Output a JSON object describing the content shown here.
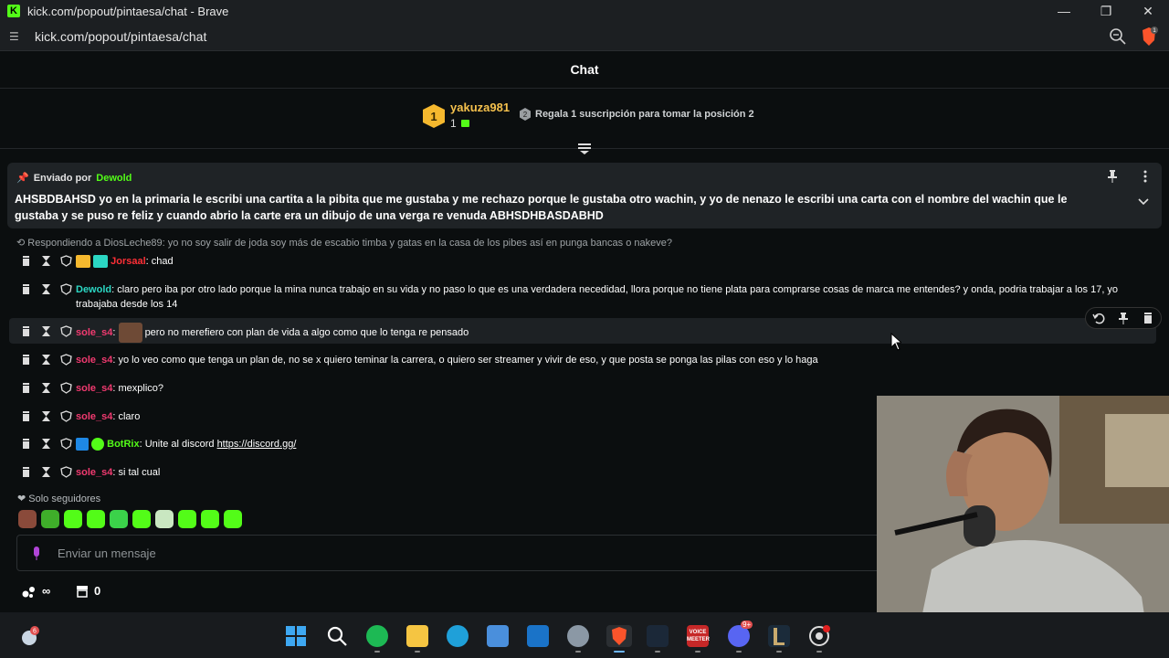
{
  "browser": {
    "window_title": "kick.com/popout/pintaesa/chat - Brave",
    "url": "kick.com/popout/pintaesa/chat",
    "brave_badge": "1"
  },
  "chat": {
    "header": "Chat",
    "leaderboard": {
      "rank": "1",
      "username": "yakuza981",
      "count": "1",
      "message": "Regala 1 suscripción para tomar la posición 2"
    },
    "pinned": {
      "sent_by_label": "Enviado por",
      "sent_by_user": "Dewold",
      "text": "AHSBDBAHSD yo en la primaria le escribi una cartita a la pibita que me gustaba y me rechazo porque le gustaba otro wachin, y yo de nenazo le escribi una carta con el nombre del wachin que le gustaba y se puso re feliz y cuando abrio la carte era un dibujo de una verga re venuda ABHSDHBASDABHD"
    },
    "reply": "Respondiendo a DiosLeche89: yo no soy salir de joda soy más de escabio timba y gatas en la casa de los pibes así en punga bancas o nakeve?",
    "messages": [
      {
        "user": "Jorsaal",
        "text": ": chad"
      },
      {
        "user": "Dewold",
        "text": ": claro pero iba por otro lado porque la mina nunca trabajo en su vida y no paso lo que es una verdadera necedidad, llora porque no tiene plata para comprarse cosas de marca me entendes? y onda, podria trabajar a los 17, yo trabajaba desde los 14"
      },
      {
        "user": "sole_s4",
        "text": " pero no merefiero con plan de vida a algo como que lo tenga re pensado"
      },
      {
        "user": "sole_s4",
        "text": ": yo lo veo como que tenga un plan de, no se x quiero teminar la carrera, o quiero ser streamer y vivir de eso, y que posta se ponga las pilas con eso y lo haga"
      },
      {
        "user": "sole_s4",
        "text": ": mexplico?"
      },
      {
        "user": "sole_s4",
        "text": ": claro"
      },
      {
        "user": "BotRix",
        "text": ": Unite al discord ",
        "link": "https://discord.gg/"
      },
      {
        "user": "sole_s4",
        "text": ": si tal cual"
      }
    ],
    "followers_only": "Solo seguidores",
    "input_placeholder": "Enviar un mensaje",
    "points": "∞",
    "store_count": "0"
  },
  "taskbar": {
    "weather_badge": "6",
    "discord_badge": "9+",
    "voicemeeter_label": "VOICE MEETER"
  },
  "colors": {
    "kick_green": "#53fc18",
    "username_pink": "#f13a70",
    "leader_gold": "#f5c14d",
    "background": "#0b0e0f"
  }
}
